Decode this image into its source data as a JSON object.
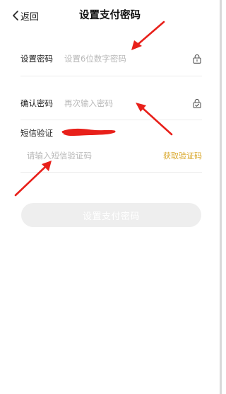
{
  "header": {
    "back_label": "返回",
    "title": "设置支付密码"
  },
  "form": {
    "password": {
      "label": "设置密码",
      "placeholder": "设置6位数字密码",
      "icon": "lock-icon"
    },
    "confirm": {
      "label": "确认密码",
      "placeholder": "再次输入密码",
      "icon": "lock-check-icon"
    },
    "sms": {
      "label": "短信验证",
      "placeholder": "请输入短信验证码",
      "get_code_label": "获取验证码"
    }
  },
  "submit": {
    "label": "设置支付密码"
  },
  "colors": {
    "accent": "#d9a72a",
    "annotation_red": "#e8201a",
    "button_disabled": "#eeeeee"
  }
}
